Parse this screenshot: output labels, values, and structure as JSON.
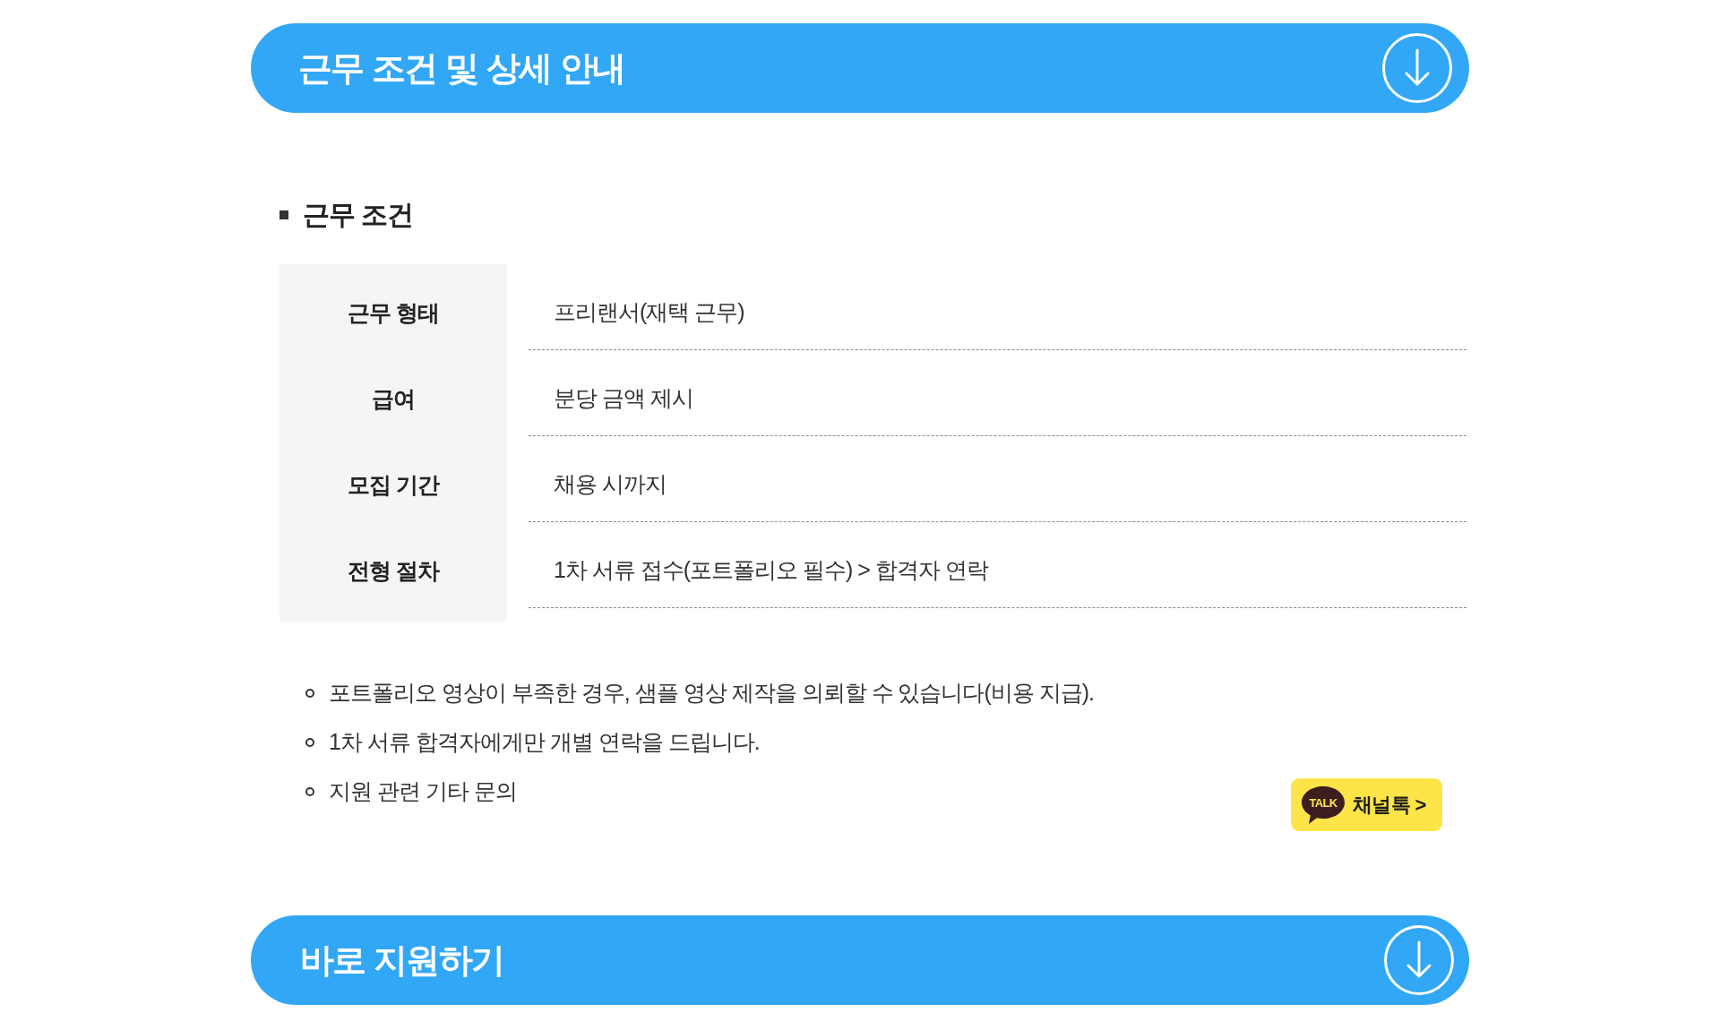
{
  "header_banner": {
    "title": "근무 조건 및 상세 안내"
  },
  "section": {
    "title": "근무 조건"
  },
  "conditions_table": {
    "rows": [
      {
        "label": "근무 형태",
        "value": "프리랜서(재택 근무)"
      },
      {
        "label": "급여",
        "value": "분당 금액 제시"
      },
      {
        "label": "모집 기간",
        "value": "채용 시까지"
      },
      {
        "label": "전형 절차",
        "value": "1차 서류 접수(포트폴리오 필수) > 합격자 연락"
      }
    ]
  },
  "notes": [
    "포트폴리오 영상이 부족한 경우, 샘플 영상 제작을 의뢰할 수 있습니다(비용 지급).",
    "1차 서류 합격자에게만 개별 연락을 드립니다.",
    "지원 관련 기타 문의"
  ],
  "kakao_button": {
    "logo_text": "TALK",
    "label": "채널톡 >"
  },
  "apply_banner": {
    "title": "바로 지원하기"
  }
}
